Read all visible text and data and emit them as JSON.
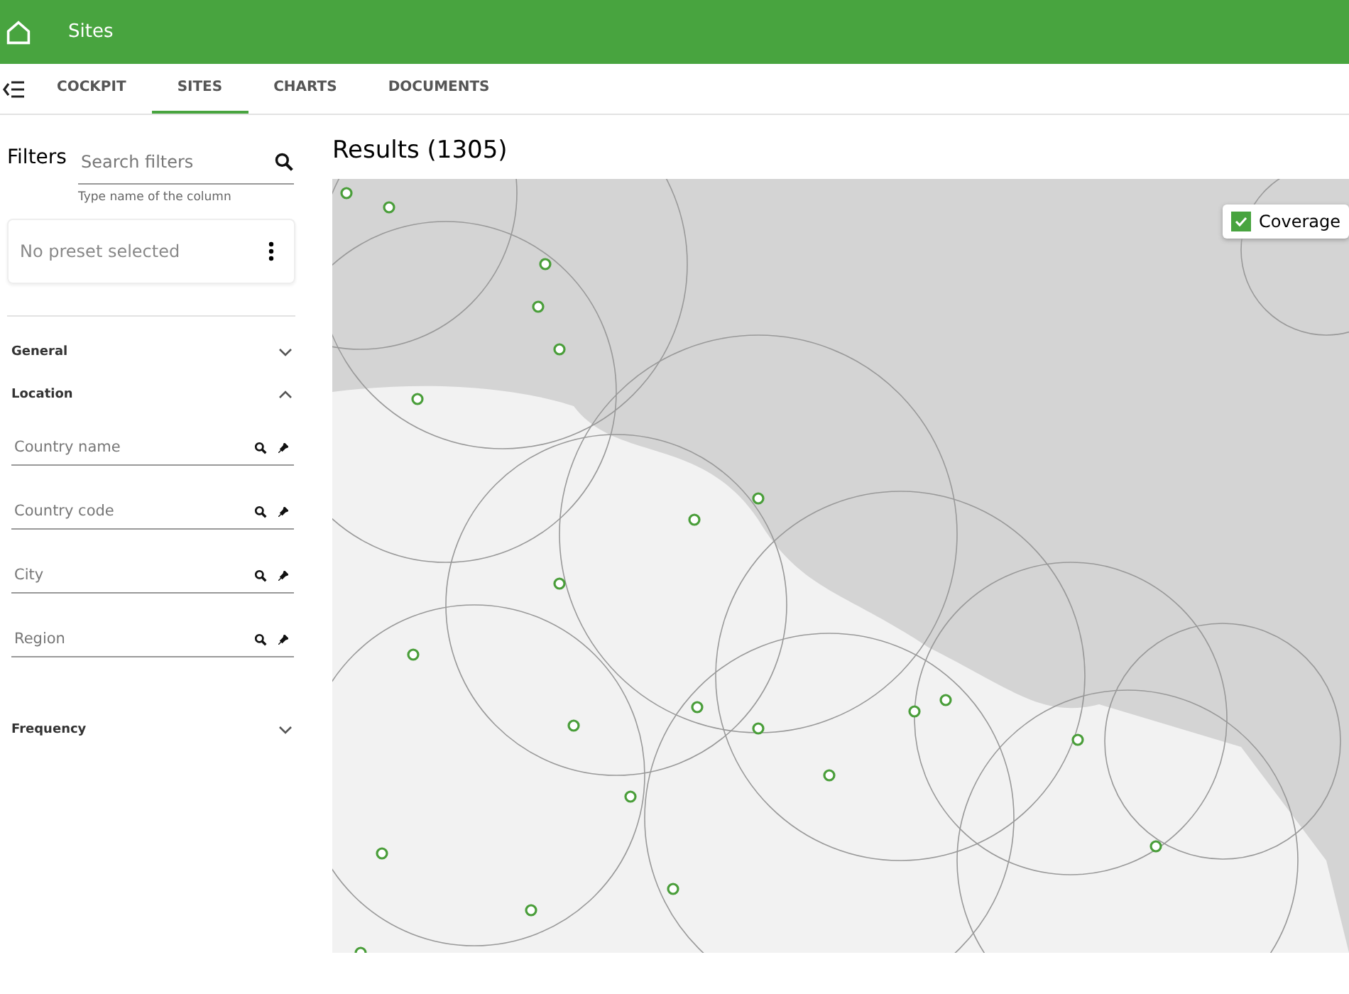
{
  "header": {
    "title": "Sites"
  },
  "tabs": [
    {
      "label": "COCKPIT",
      "selected": false
    },
    {
      "label": "SITES",
      "selected": true
    },
    {
      "label": "CHARTS",
      "selected": false
    },
    {
      "label": "DOCUMENTS",
      "selected": false
    }
  ],
  "filters": {
    "title": "Filters",
    "search": {
      "placeholder": "Search filters",
      "hint": "Type name of the column"
    },
    "preset": "No preset selected",
    "sections": [
      {
        "label": "General",
        "expanded": false
      },
      {
        "label": "Location",
        "expanded": true,
        "fields": [
          {
            "placeholder": "Country name"
          },
          {
            "placeholder": "Country code"
          },
          {
            "placeholder": "City"
          },
          {
            "placeholder": "Region"
          }
        ]
      },
      {
        "label": "Frequency",
        "expanded": false
      }
    ]
  },
  "results": {
    "title": "Results (1305)",
    "layer": {
      "label": "Coverage",
      "checked": true
    }
  }
}
